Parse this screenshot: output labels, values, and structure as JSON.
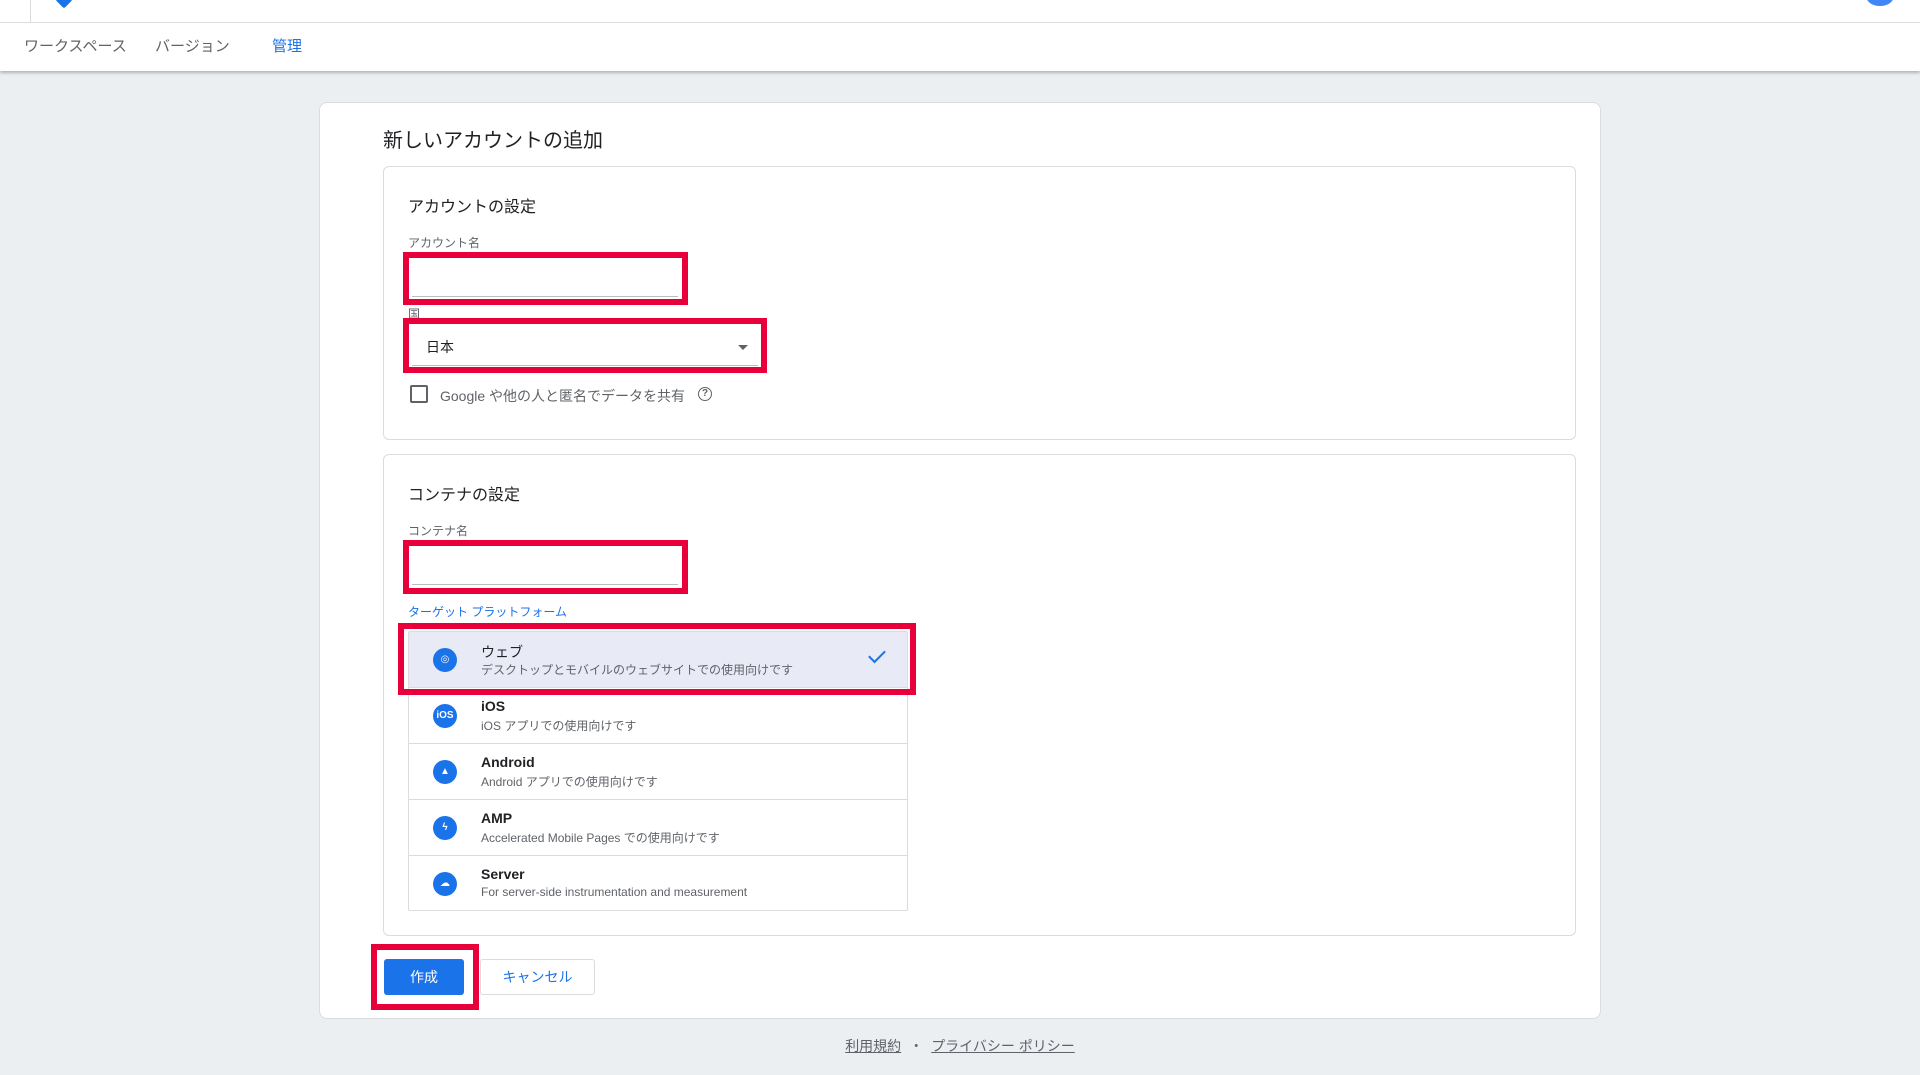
{
  "nav": {
    "tabs": [
      {
        "label": "ワークスペース"
      },
      {
        "label": "バージョン"
      },
      {
        "label": "管理"
      }
    ]
  },
  "page": {
    "title": "新しいアカウントの追加"
  },
  "account_section": {
    "title": "アカウントの設定",
    "account_name_label": "アカウント名",
    "account_name_value": "",
    "country_label": "国",
    "country_value": "日本",
    "share_checkbox_label": "Google や他の人と匿名でデータを共有",
    "share_checked": false
  },
  "container_section": {
    "title": "コンテナの設定",
    "container_name_label": "コンテナ名",
    "container_name_value": "",
    "target_platform_label": "ターゲット プラットフォーム",
    "platforms": [
      {
        "name": "ウェブ",
        "desc": "デスクトップとモバイルのウェブサイトでの使用向けです",
        "icon": "globe-icon",
        "selected": true
      },
      {
        "name": "iOS",
        "desc": "iOS アプリでの使用向けです",
        "icon": "ios-icon",
        "selected": false
      },
      {
        "name": "Android",
        "desc": "Android アプリでの使用向けです",
        "icon": "android-icon",
        "selected": false
      },
      {
        "name": "AMP",
        "desc": "Accelerated Mobile Pages での使用向けです",
        "icon": "bolt-icon",
        "selected": false
      },
      {
        "name": "Server",
        "desc": "For server-side instrumentation and measurement",
        "icon": "cloud-icon",
        "selected": false
      }
    ]
  },
  "actions": {
    "create_label": "作成",
    "cancel_label": "キャンセル"
  },
  "footer": {
    "terms": "利用規約",
    "separator": "・",
    "privacy": "プライバシー ポリシー"
  },
  "colors": {
    "accent": "#1a73e8",
    "highlight": "#e8003b",
    "background": "#eceff1"
  }
}
